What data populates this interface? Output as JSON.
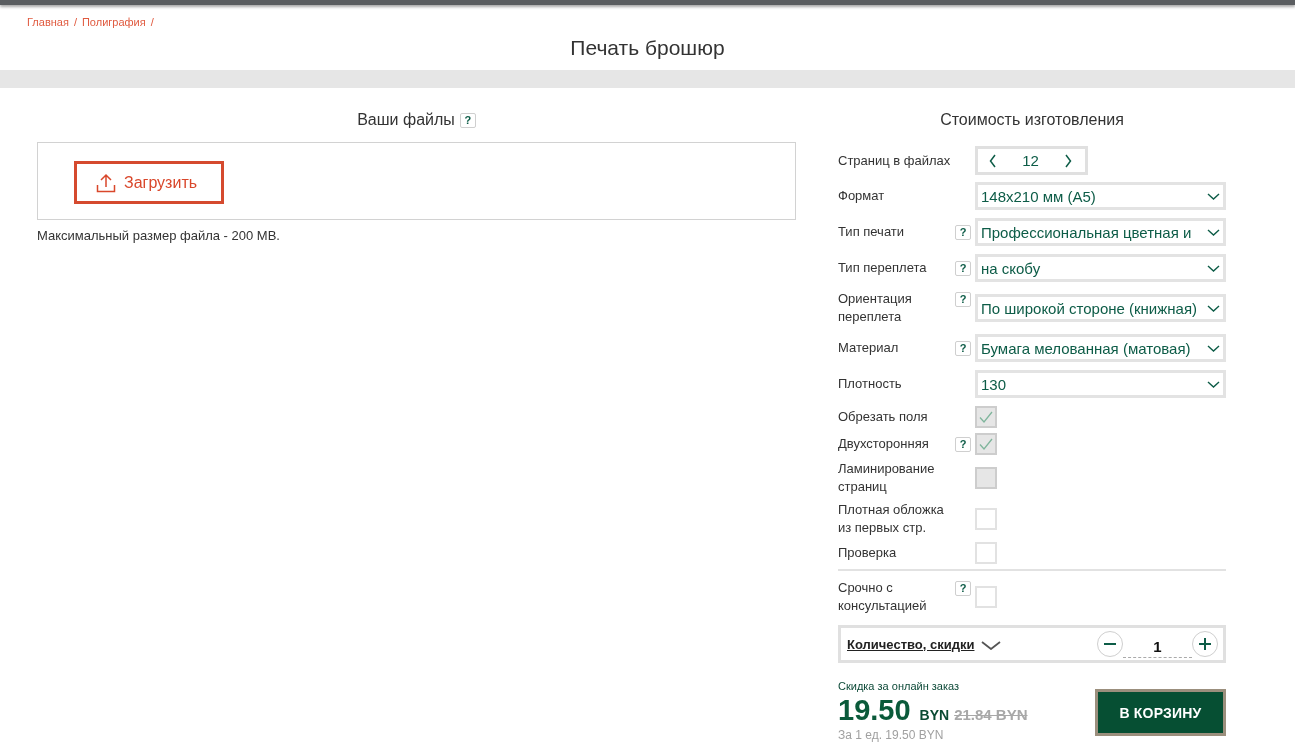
{
  "breadcrumb": {
    "items": [
      "Главная",
      "Полиграфия"
    ],
    "separator": "/"
  },
  "title": "Печать брошюр",
  "files": {
    "heading": "Ваши файлы",
    "help": "?",
    "upload_button": "Загрузить",
    "note": "Максимальный размер файла - 200 MB."
  },
  "cost": {
    "heading": "Стоимость изготовления",
    "options": [
      {
        "kind": "stepper",
        "label": "Страниц в файлах",
        "value": "12"
      },
      {
        "kind": "select",
        "label": "Формат",
        "value": "148x210 мм (A5)"
      },
      {
        "kind": "select",
        "label": "Тип печати",
        "help": "?",
        "value": "Профессиональная цветная и"
      },
      {
        "kind": "select",
        "label": "Тип переплета",
        "help": "?",
        "value": "на скобу"
      },
      {
        "kind": "select",
        "label": "Ориентация переплета",
        "help": "?",
        "value": "По широкой стороне (книжная)"
      },
      {
        "kind": "select",
        "label": "Материал",
        "help": "?",
        "value": "Бумага мелованная (матовая)"
      },
      {
        "kind": "select",
        "label": "Плотность",
        "value": "130"
      },
      {
        "kind": "checkbox",
        "label": "Обрезать поля",
        "checked": true,
        "disabled": true
      },
      {
        "kind": "checkbox",
        "label": "Двухсторонняя",
        "help": "?",
        "checked": true,
        "disabled": true
      },
      {
        "kind": "checkbox",
        "label": "Ламинирование страниц",
        "checked": false,
        "disabled": true
      },
      {
        "kind": "checkbox",
        "label": "Плотная обложка из первых стр.",
        "checked": false,
        "disabled": false
      },
      {
        "kind": "checkbox",
        "label": "Проверка",
        "checked": false,
        "disabled": false
      }
    ],
    "extras": [
      {
        "kind": "checkbox",
        "label": "Срочно с консультацией",
        "help": "?",
        "checked": false,
        "disabled": false
      }
    ]
  },
  "quantity": {
    "label": "Количество, скидки",
    "value": "1"
  },
  "price": {
    "discount_note": "Скидка за онлайн заказ",
    "amount": "19.50",
    "currency": "BYN",
    "old_price": "21.84 BYN",
    "unit_price": "За 1 ед. 19.50 BYN"
  },
  "cart_button": "В КОРЗИНУ"
}
